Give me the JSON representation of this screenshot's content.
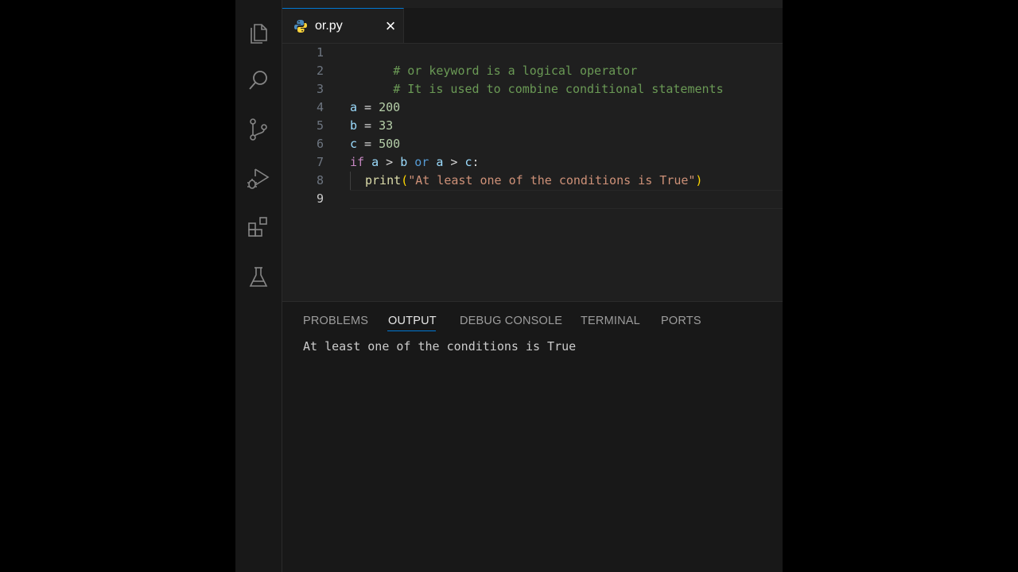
{
  "editor": {
    "tab": {
      "filename": "or.py"
    },
    "lines": [
      {
        "number": "1",
        "comment": "# or keyword is a logical operator"
      },
      {
        "number": "2",
        "comment": "# It is used to combine conditional statements"
      },
      {
        "number": "3"
      },
      {
        "number": "4",
        "var": "a",
        "op": " = ",
        "num": "200"
      },
      {
        "number": "5",
        "var": "b",
        "op": " = ",
        "num": "33"
      },
      {
        "number": "6",
        "var": "c",
        "op": " = ",
        "num": "500"
      },
      {
        "number": "7",
        "kw": "if",
        "t1": " a",
        "t2": " > ",
        "t3": "b",
        "t4": " or",
        "t5": " a",
        "t6": " > ",
        "t7": "c",
        "t8": ":"
      },
      {
        "number": "8",
        "fn": "print",
        "lp": "(",
        "str": "\"At least one of the conditions is True\"",
        "rp": ")"
      },
      {
        "number": "9"
      }
    ]
  },
  "panel": {
    "tabs": [
      "PROBLEMS",
      "OUTPUT",
      "DEBUG CONSOLE",
      "TERMINAL",
      "PORTS"
    ],
    "active_tab": "OUTPUT",
    "output": "At least one of the conditions is True"
  },
  "colors": {
    "accent": "#0078d4",
    "comment": "#6a9955",
    "variable": "#9cdcfe",
    "number": "#b5cea8",
    "keyword": "#c586c0",
    "string": "#ce9178"
  },
  "icons": {
    "activity_bar": [
      "explorer-icon",
      "search-icon",
      "source-control-icon",
      "run-debug-icon",
      "extensions-icon",
      "testing-icon"
    ],
    "tab": [
      "python-file-icon",
      "close-icon"
    ]
  }
}
